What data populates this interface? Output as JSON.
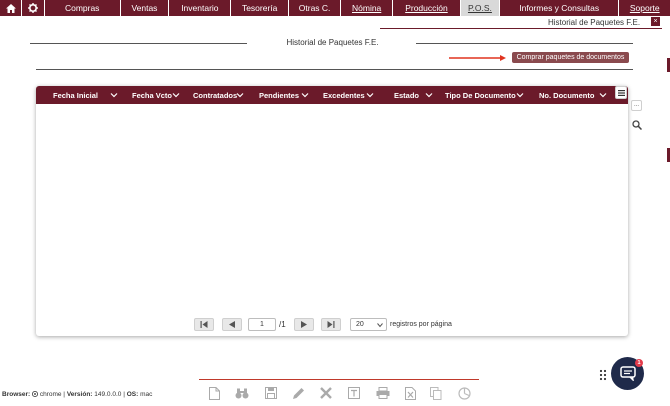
{
  "nav": {
    "items": [
      "Compras",
      "Ventas",
      "Inventario",
      "Tesorería",
      "Otras C.",
      "Nómina",
      "Producción",
      "P.O.S.",
      "Informes y Consultas",
      "Soporte"
    ],
    "active": "P.O.S.",
    "home_icon": "home-icon",
    "settings_icon": "gear-icon"
  },
  "breadcrumb": {
    "tab_label": "Historial de Paquetes F.E.",
    "close_label": "×"
  },
  "page": {
    "title": "Historial de Paquetes F.E.",
    "buy_button": "Comprar paquetes de documentos"
  },
  "grid": {
    "columns": [
      "Fecha Inicial",
      "Fecha Vcto",
      "Contratados",
      "Pendientes",
      "Excedentes",
      "Estado",
      "Tipo De Documento",
      "No. Documento"
    ],
    "rows": []
  },
  "pager": {
    "page": "1",
    "total": "/1",
    "page_size": "20",
    "label": "registros por página"
  },
  "side_tools": {
    "more_label": "..."
  },
  "toolbar": [
    "new-document-icon",
    "binoculars-icon",
    "save-icon",
    "edit-icon",
    "delete-icon",
    "text-icon",
    "print-icon",
    "excel-icon",
    "copy-icon",
    "chart-icon"
  ],
  "status": {
    "browser_label": "Browser:",
    "browser": "chrome",
    "version_label": "Versión:",
    "version": "149.0.0.0",
    "os_label": "OS:",
    "os": "mac"
  },
  "chat": {
    "badge": "1"
  },
  "colors": {
    "primary": "#6b1a2a",
    "accent_line": "#c0392b",
    "button": "#8a4a4e",
    "chat": "#1f2a4a",
    "badge": "#e23b4b"
  }
}
